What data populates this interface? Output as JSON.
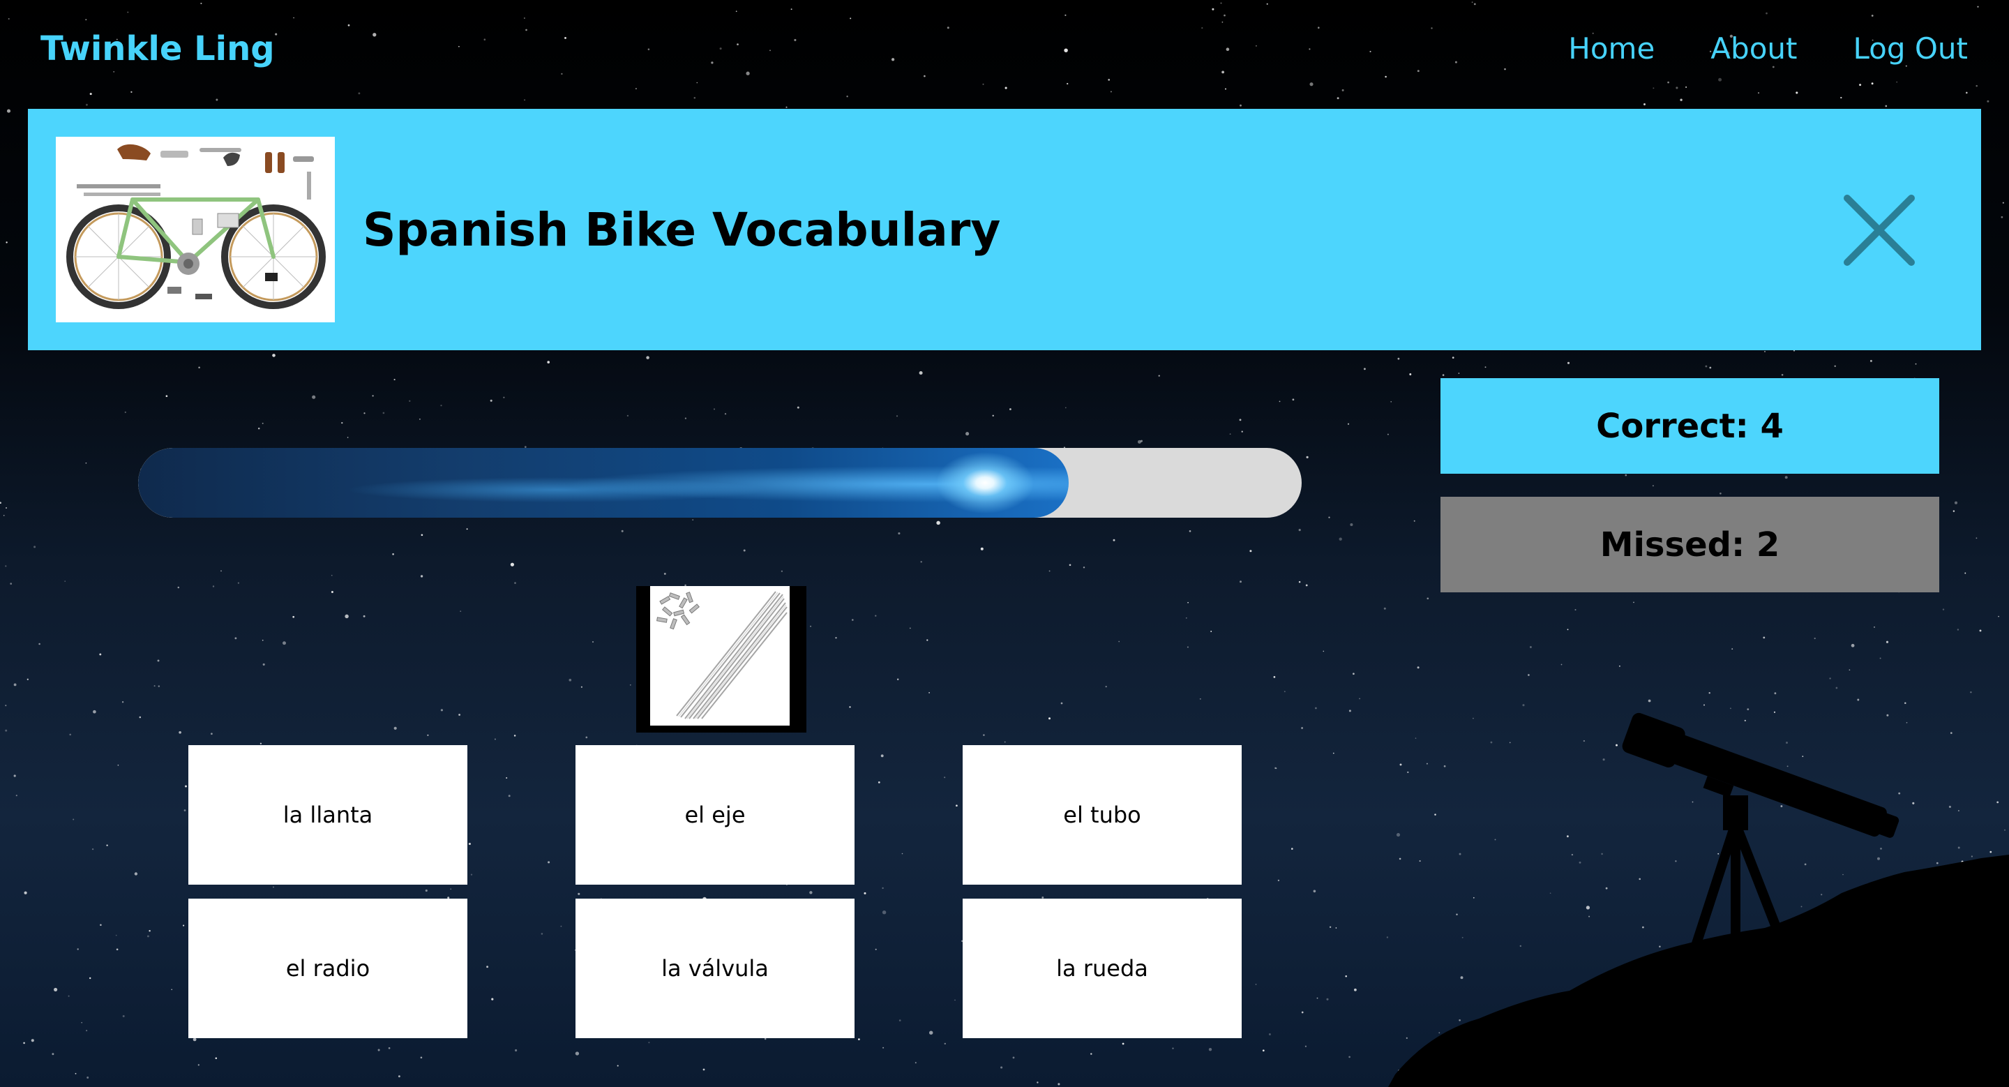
{
  "app": {
    "brand": "Twinkle Ling"
  },
  "nav": {
    "items": [
      {
        "label": "Home"
      },
      {
        "label": "About"
      },
      {
        "label": "Log Out"
      }
    ]
  },
  "header": {
    "title": "Spanish Bike Vocabulary",
    "thumbnail_icon": "bicycle-parts-image",
    "close_icon": "close-icon"
  },
  "score": {
    "correct_label": "Correct: 4",
    "missed_label": "Missed: 2",
    "correct": 4,
    "missed": 2
  },
  "progress": {
    "fraction": 0.8
  },
  "question": {
    "image_icon": "bicycle-spokes-image"
  },
  "answers": [
    {
      "label": "la llanta"
    },
    {
      "label": "el eje"
    },
    {
      "label": "el tubo"
    },
    {
      "label": "el radio"
    },
    {
      "label": "la válvula"
    },
    {
      "label": "la rueda"
    }
  ],
  "colors": {
    "accent": "#4dd5fd",
    "brand_text": "#47d3fb",
    "missed_panel": "#7f7f7f",
    "close_icon": "#2a7f96",
    "progress_track": "#dadada"
  }
}
